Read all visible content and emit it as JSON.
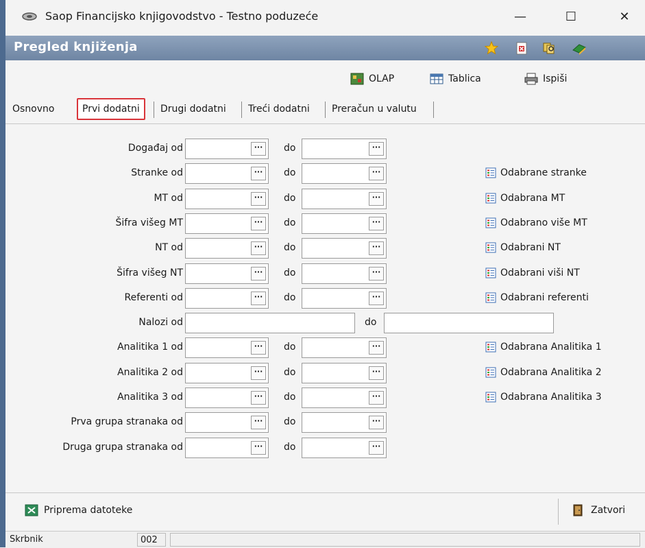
{
  "window": {
    "title": "Saop Financijsko knjigovodstvo - Testno poduzeće",
    "minimize": "—",
    "maximize": "☐",
    "close": "✕"
  },
  "header": {
    "title": "Pregled knjiženja",
    "icons": [
      "star-icon",
      "delete-document-icon",
      "search-files-icon",
      "book-icon"
    ]
  },
  "toolbar": {
    "olap": "OLAP",
    "tablica": "Tablica",
    "ispisi": "Ispiši"
  },
  "tabs": [
    {
      "label": "Osnovno"
    },
    {
      "label": "Prvi dodatni"
    },
    {
      "label": "Drugi dodatni"
    },
    {
      "label": "Treći dodatni"
    },
    {
      "label": "Preračun u valutu"
    }
  ],
  "form": {
    "do_label": "do",
    "rows": [
      {
        "label": "Događaj od",
        "from": "",
        "to": "",
        "select": ""
      },
      {
        "label": "Stranke od",
        "from": "",
        "to": "",
        "select": "Odabrane stranke"
      },
      {
        "label": "MT od",
        "from": "",
        "to": "",
        "select": "Odabrana MT"
      },
      {
        "label": "Šifra višeg MT",
        "from": "",
        "to": "",
        "select": "Odabrano više MT"
      },
      {
        "label": "NT od",
        "from": "",
        "to": "",
        "select": "Odabrani NT"
      },
      {
        "label": "Šifra višeg NT",
        "from": "",
        "to": "",
        "select": "Odabrani viši NT"
      },
      {
        "label": "Referenti od",
        "from": "",
        "to": "",
        "select": "Odabrani referenti"
      },
      {
        "label": "Nalozi od",
        "from": "",
        "to": "",
        "select": ""
      },
      {
        "label": "Analitika 1 od",
        "from": "",
        "to": "",
        "select": "Odabrana Analitika 1"
      },
      {
        "label": "Analitika 2 od",
        "from": "",
        "to": "",
        "select": "Odabrana Analitika 2"
      },
      {
        "label": "Analitika 3 od",
        "from": "",
        "to": "",
        "select": "Odabrana Analitika 3"
      },
      {
        "label": "Prva grupa stranaka od",
        "from": "",
        "to": "",
        "select": ""
      },
      {
        "label": "Druga grupa stranaka od",
        "from": "",
        "to": "",
        "select": ""
      }
    ],
    "browse_label": "···"
  },
  "bottom": {
    "priprema": "Priprema datoteke",
    "zatvori": "Zatvori"
  },
  "status": {
    "user": "Skrbnik",
    "code": "002"
  },
  "colors": {
    "header_bg": "#7a8fad",
    "active_tab_border": "#d9343a",
    "window_left_accent": "#4d6a8f"
  }
}
